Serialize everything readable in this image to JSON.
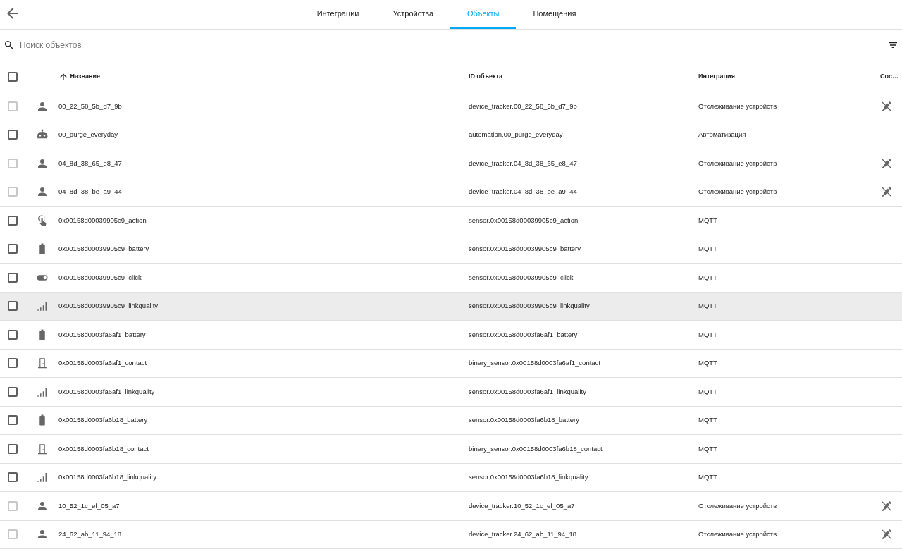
{
  "tabs": [
    {
      "label": "Интеграции",
      "selected": false
    },
    {
      "label": "Устройства",
      "selected": false
    },
    {
      "label": "Объекты",
      "selected": true
    },
    {
      "label": "Помещения",
      "selected": false
    }
  ],
  "search": {
    "placeholder": "Поиск объектов"
  },
  "select_all": {
    "checked": false
  },
  "columns": [
    {
      "label": "Название",
      "sorted": true
    },
    {
      "label": "ID объекта",
      "sorted": false
    },
    {
      "label": "Интеграция",
      "sorted": false
    },
    {
      "label": "Сос…",
      "sorted": false
    }
  ],
  "rows": [
    {
      "kind": "person",
      "name": "00_22_58_5b_d7_9b",
      "entity_id": "device_tracker.00_22_58_5b_d7_9b",
      "integration": "Отслеживание устройств",
      "checked": false,
      "checkbox_disabled": true,
      "unavailable": true,
      "hovered": false
    },
    {
      "kind": "robot",
      "name": "00_purge_everyday",
      "entity_id": "automation.00_purge_everyday",
      "integration": "Автоматизация",
      "checked": false,
      "checkbox_disabled": false,
      "unavailable": false,
      "hovered": false
    },
    {
      "kind": "person",
      "name": "04_8d_38_65_e8_47",
      "entity_id": "device_tracker.04_8d_38_65_e8_47",
      "integration": "Отслеживание устройств",
      "checked": false,
      "checkbox_disabled": true,
      "unavailable": true,
      "hovered": false
    },
    {
      "kind": "person",
      "name": "04_8d_38_be_a9_44",
      "entity_id": "device_tracker.04_8d_38_be_a9_44",
      "integration": "Отслеживание устройств",
      "checked": false,
      "checkbox_disabled": true,
      "unavailable": true,
      "hovered": false
    },
    {
      "kind": "gesture",
      "name": "0x00158d00039905c9_action",
      "entity_id": "sensor.0x00158d00039905c9_action",
      "integration": "MQTT",
      "checked": false,
      "checkbox_disabled": false,
      "unavailable": false,
      "hovered": false
    },
    {
      "kind": "battery",
      "name": "0x00158d00039905c9_battery",
      "entity_id": "sensor.0x00158d00039905c9_battery",
      "integration": "MQTT",
      "checked": false,
      "checkbox_disabled": false,
      "unavailable": false,
      "hovered": false
    },
    {
      "kind": "toggle",
      "name": "0x00158d00039905c9_click",
      "entity_id": "sensor.0x00158d00039905c9_click",
      "integration": "MQTT",
      "checked": false,
      "checkbox_disabled": false,
      "unavailable": false,
      "hovered": false
    },
    {
      "kind": "signal",
      "name": "0x00158d00039905c9_linkquality",
      "entity_id": "sensor.0x00158d00039905c9_linkquality",
      "integration": "MQTT",
      "checked": false,
      "checkbox_disabled": false,
      "unavailable": false,
      "hovered": true
    },
    {
      "kind": "battery",
      "name": "0x00158d0003fa6af1_battery",
      "entity_id": "sensor.0x00158d0003fa6af1_battery",
      "integration": "MQTT",
      "checked": false,
      "checkbox_disabled": false,
      "unavailable": false,
      "hovered": false
    },
    {
      "kind": "door",
      "name": "0x00158d0003fa6af1_contact",
      "entity_id": "binary_sensor.0x00158d0003fa6af1_contact",
      "integration": "MQTT",
      "checked": false,
      "checkbox_disabled": false,
      "unavailable": false,
      "hovered": false
    },
    {
      "kind": "signal",
      "name": "0x00158d0003fa6af1_linkquality",
      "entity_id": "sensor.0x00158d0003fa6af1_linkquality",
      "integration": "MQTT",
      "checked": false,
      "checkbox_disabled": false,
      "unavailable": false,
      "hovered": false
    },
    {
      "kind": "battery",
      "name": "0x00158d0003fa6b18_battery",
      "entity_id": "sensor.0x00158d0003fa6b18_battery",
      "integration": "MQTT",
      "checked": false,
      "checkbox_disabled": false,
      "unavailable": false,
      "hovered": false
    },
    {
      "kind": "door",
      "name": "0x00158d0003fa6b18_contact",
      "entity_id": "binary_sensor.0x00158d0003fa6b18_contact",
      "integration": "MQTT",
      "checked": false,
      "checkbox_disabled": false,
      "unavailable": false,
      "hovered": false
    },
    {
      "kind": "signal",
      "name": "0x00158d0003fa6b18_linkquality",
      "entity_id": "sensor.0x00158d0003fa6b18_linkquality",
      "integration": "MQTT",
      "checked": false,
      "checkbox_disabled": false,
      "unavailable": false,
      "hovered": false
    },
    {
      "kind": "person",
      "name": "10_52_1c_ef_05_a7",
      "entity_id": "device_tracker.10_52_1c_ef_05_a7",
      "integration": "Отслеживание устройств",
      "checked": false,
      "checkbox_disabled": true,
      "unavailable": true,
      "hovered": false
    },
    {
      "kind": "person",
      "name": "24_62_ab_11_94_18",
      "entity_id": "device_tracker.24_62_ab_11_94_18",
      "integration": "Отслеживание устройств",
      "checked": false,
      "checkbox_disabled": true,
      "unavailable": true,
      "hovered": false
    }
  ]
}
